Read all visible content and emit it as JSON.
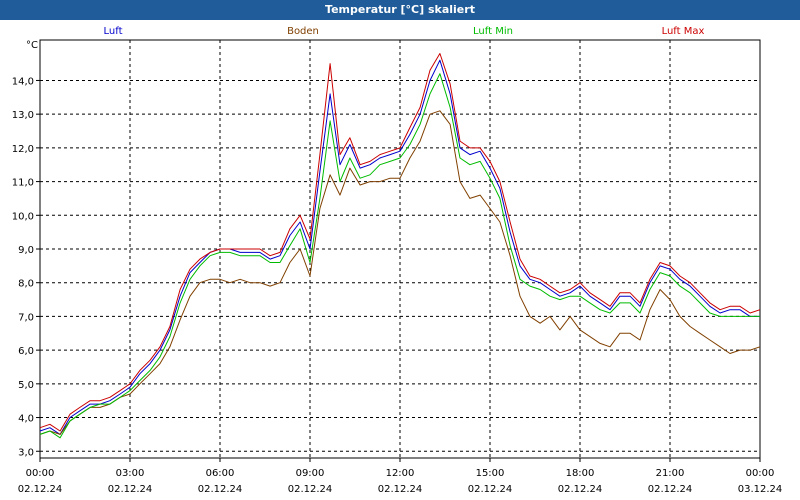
{
  "window": {
    "title": "Temperatur [°C] skaliert"
  },
  "chart_data": {
    "type": "line",
    "title": "Temperatur [°C] skaliert",
    "ylabel": "°C",
    "ylim": [
      2.8,
      15.2
    ],
    "yticks": [
      "3,0",
      "4,0",
      "5,0",
      "6,0",
      "7,0",
      "8,0",
      "9,0",
      "10,0",
      "11,0",
      "12,0",
      "13,0",
      "14,0"
    ],
    "xlim_hours": [
      0,
      24
    ],
    "xticks": [
      {
        "time": "00:00",
        "date": "02.12.24"
      },
      {
        "time": "03:00",
        "date": "02.12.24"
      },
      {
        "time": "06:00",
        "date": "02.12.24"
      },
      {
        "time": "09:00",
        "date": "02.12.24"
      },
      {
        "time": "12:00",
        "date": "02.12.24"
      },
      {
        "time": "15:00",
        "date": "02.12.24"
      },
      {
        "time": "18:00",
        "date": "02.12.24"
      },
      {
        "time": "21:00",
        "date": "02.12.24"
      },
      {
        "time": "00:00",
        "date": "03.12.24"
      }
    ],
    "grid": true,
    "legend_position": "top",
    "x": [
      0,
      0.33,
      0.67,
      1,
      1.33,
      1.67,
      2,
      2.33,
      2.67,
      3,
      3.33,
      3.67,
      4,
      4.33,
      4.67,
      5,
      5.33,
      5.67,
      6,
      6.33,
      6.67,
      7,
      7.33,
      7.67,
      8,
      8.33,
      8.67,
      9,
      9.33,
      9.67,
      10,
      10.33,
      10.67,
      11,
      11.33,
      11.67,
      12,
      12.33,
      12.67,
      13,
      13.33,
      13.67,
      14,
      14.33,
      14.67,
      15,
      15.33,
      15.67,
      16,
      16.33,
      16.67,
      17,
      17.33,
      17.67,
      18,
      18.33,
      18.67,
      19,
      19.33,
      19.67,
      20,
      20.33,
      20.67,
      21,
      21.33,
      21.67,
      22,
      22.33,
      22.67,
      23,
      23.33,
      23.67,
      24
    ],
    "series": [
      {
        "name": "Luft",
        "color": "#0000cc",
        "values": [
          3.6,
          3.7,
          3.5,
          4.0,
          4.2,
          4.4,
          4.4,
          4.5,
          4.7,
          4.9,
          5.3,
          5.6,
          6.0,
          6.6,
          7.6,
          8.3,
          8.6,
          8.9,
          9.0,
          9.0,
          8.9,
          8.9,
          8.9,
          8.7,
          8.8,
          9.4,
          9.8,
          9.0,
          11.3,
          13.6,
          11.5,
          12.1,
          11.4,
          11.5,
          11.7,
          11.8,
          11.9,
          12.4,
          13.0,
          14.0,
          14.6,
          13.6,
          12.0,
          11.8,
          11.9,
          11.4,
          10.8,
          9.5,
          8.5,
          8.1,
          8.0,
          7.8,
          7.6,
          7.7,
          7.9,
          7.6,
          7.4,
          7.2,
          7.6,
          7.6,
          7.3,
          8.0,
          8.5,
          8.4,
          8.1,
          7.9,
          7.6,
          7.3,
          7.1,
          7.2,
          7.2,
          7.0,
          7.0
        ]
      },
      {
        "name": "Boden",
        "color": "#804000",
        "values": [
          3.5,
          3.6,
          3.5,
          3.9,
          4.1,
          4.3,
          4.3,
          4.4,
          4.6,
          4.7,
          5.0,
          5.3,
          5.6,
          6.1,
          6.9,
          7.6,
          8.0,
          8.1,
          8.1,
          8.0,
          8.1,
          8.0,
          8.0,
          7.9,
          8.0,
          8.6,
          9.0,
          8.2,
          10.2,
          11.2,
          10.6,
          11.4,
          10.9,
          11.0,
          11.0,
          11.1,
          11.1,
          11.7,
          12.2,
          13.0,
          13.1,
          12.7,
          11.0,
          10.5,
          10.6,
          10.2,
          9.8,
          8.8,
          7.6,
          7.0,
          6.8,
          7.0,
          6.6,
          7.0,
          6.6,
          6.4,
          6.2,
          6.1,
          6.5,
          6.5,
          6.3,
          7.2,
          7.8,
          7.5,
          7.0,
          6.7,
          6.5,
          6.3,
          6.1,
          5.9,
          6.0,
          6.0,
          6.1
        ]
      },
      {
        "name": "Luft Min",
        "color": "#00bb00",
        "values": [
          3.5,
          3.6,
          3.4,
          3.9,
          4.1,
          4.3,
          4.4,
          4.4,
          4.6,
          4.8,
          5.1,
          5.4,
          5.8,
          6.4,
          7.4,
          8.1,
          8.5,
          8.8,
          8.9,
          8.9,
          8.8,
          8.8,
          8.8,
          8.6,
          8.6,
          9.1,
          9.6,
          8.6,
          10.5,
          12.8,
          11.0,
          11.7,
          11.1,
          11.2,
          11.5,
          11.6,
          11.7,
          12.1,
          12.7,
          13.6,
          14.2,
          13.2,
          11.7,
          11.5,
          11.6,
          11.1,
          10.5,
          9.1,
          8.1,
          7.9,
          7.8,
          7.6,
          7.5,
          7.6,
          7.6,
          7.4,
          7.2,
          7.1,
          7.4,
          7.4,
          7.1,
          7.8,
          8.3,
          8.2,
          7.9,
          7.7,
          7.4,
          7.1,
          7.0,
          7.0,
          7.0,
          7.0,
          7.0
        ]
      },
      {
        "name": "Luft Max",
        "color": "#cc0000",
        "values": [
          3.7,
          3.8,
          3.6,
          4.1,
          4.3,
          4.5,
          4.5,
          4.6,
          4.8,
          5.0,
          5.4,
          5.7,
          6.1,
          6.7,
          7.8,
          8.4,
          8.7,
          8.9,
          9.0,
          9.0,
          9.0,
          9.0,
          9.0,
          8.8,
          8.9,
          9.6,
          10.0,
          9.3,
          11.8,
          14.5,
          11.8,
          12.3,
          11.5,
          11.6,
          11.8,
          11.9,
          12.0,
          12.6,
          13.2,
          14.3,
          14.8,
          13.9,
          12.2,
          12.0,
          12.0,
          11.6,
          11.0,
          9.8,
          8.7,
          8.2,
          8.1,
          7.9,
          7.7,
          7.8,
          8.0,
          7.7,
          7.5,
          7.3,
          7.7,
          7.7,
          7.4,
          8.1,
          8.6,
          8.5,
          8.2,
          8.0,
          7.7,
          7.4,
          7.2,
          7.3,
          7.3,
          7.1,
          7.2
        ]
      }
    ]
  }
}
